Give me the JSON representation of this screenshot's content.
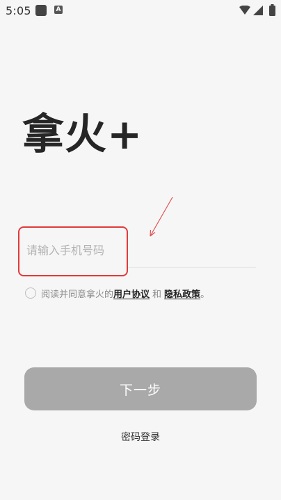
{
  "status_bar": {
    "time": "5:05",
    "notification_icons": [
      "square-app-icon",
      "a-app-icon"
    ],
    "a_icon_label": "A",
    "system_icons": [
      "wifi-icon",
      "signal-icon",
      "battery-icon"
    ]
  },
  "app": {
    "title": "拿火+"
  },
  "login_form": {
    "phone_input": {
      "placeholder": "请输入手机号码",
      "value": ""
    },
    "agreement": {
      "checked": false,
      "prefix": "阅读并同意拿火的",
      "user_agreement_label": "用户协议",
      "conjunction": "和",
      "privacy_policy_label": "隐私政策",
      "suffix": "。"
    },
    "next_button_label": "下一步",
    "password_login_label": "密码登录"
  },
  "colors": {
    "background": "#f6f6f6",
    "highlight_box": "#e23a3a",
    "button_disabled": "#a9a9a9",
    "placeholder": "#b3b3b3"
  }
}
